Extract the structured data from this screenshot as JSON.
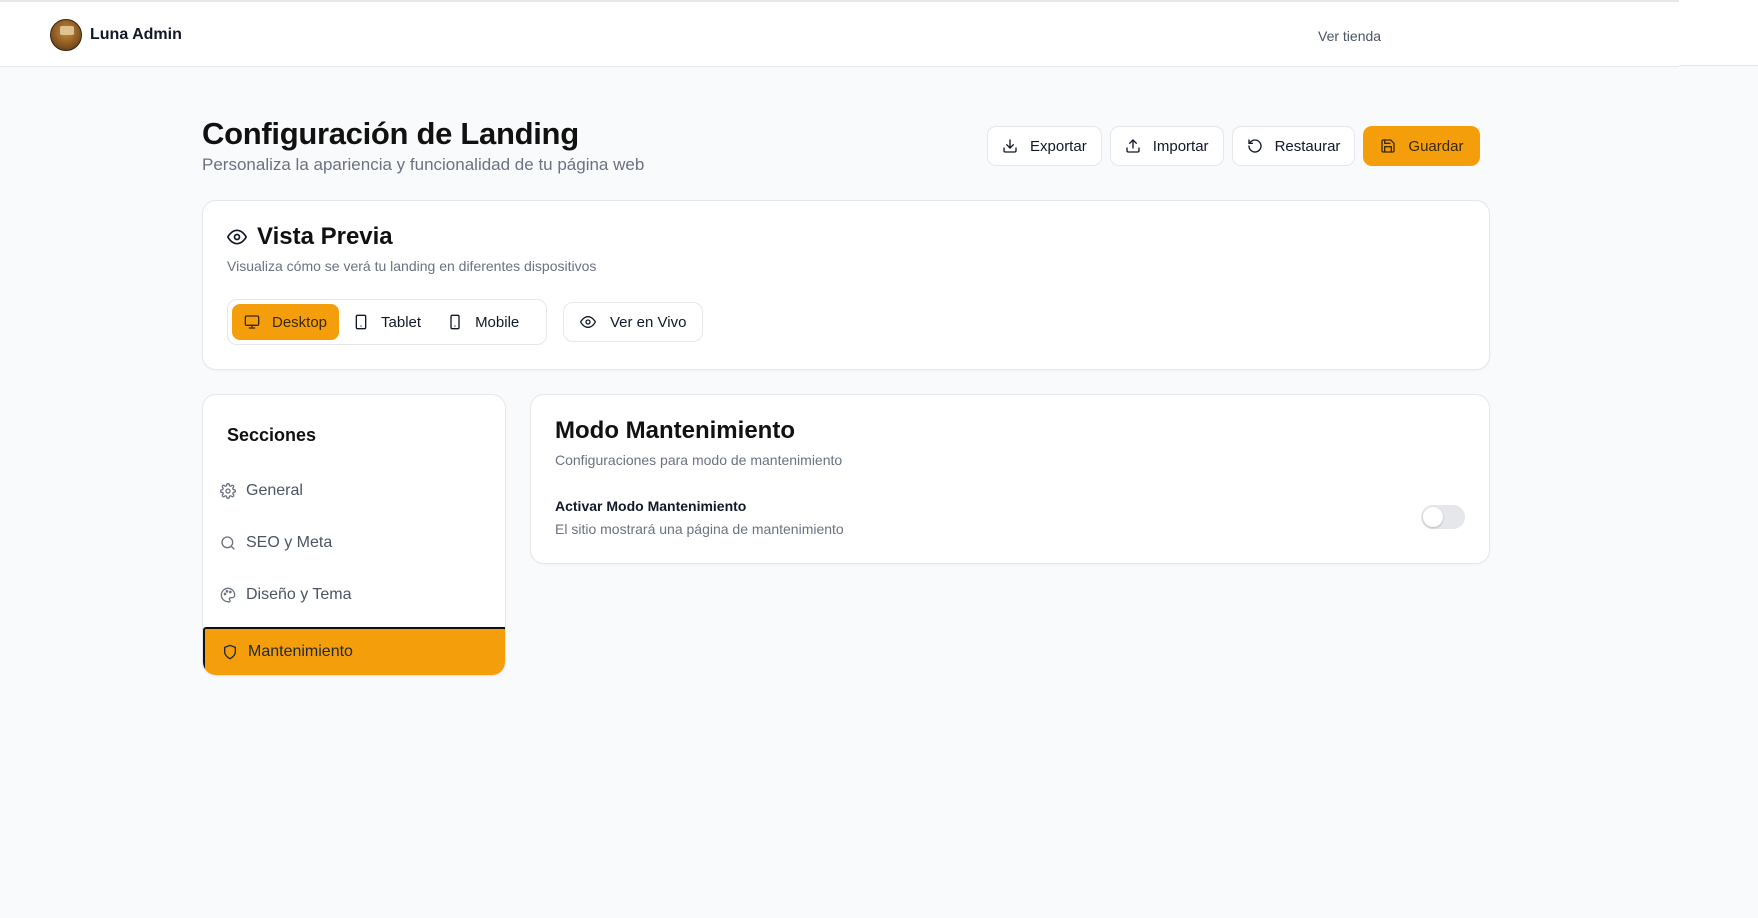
{
  "header": {
    "brand_name": "Luna Admin",
    "store_link": "Ver tienda"
  },
  "page": {
    "title": "Configuración de Landing",
    "subtitle": "Personaliza la apariencia y funcionalidad de tu página web"
  },
  "actions": {
    "export_label": "Exportar",
    "import_label": "Importar",
    "restore_label": "Restaurar",
    "save_label": "Guardar"
  },
  "preview": {
    "title": "Vista Previa",
    "description": "Visualiza cómo se verá tu landing en diferentes dispositivos",
    "devices": [
      {
        "label": "Desktop",
        "icon": "monitor-icon",
        "active": true
      },
      {
        "label": "Tablet",
        "icon": "tablet-icon",
        "active": false
      },
      {
        "label": "Mobile",
        "icon": "smartphone-icon",
        "active": false
      }
    ],
    "live_label": "Ver en Vivo"
  },
  "sections": {
    "title": "Secciones",
    "items": [
      {
        "label": "General",
        "icon": "gear-icon",
        "active": false
      },
      {
        "label": "SEO y Meta",
        "icon": "search-icon",
        "active": false
      },
      {
        "label": "Diseño y Tema",
        "icon": "palette-icon",
        "active": false
      },
      {
        "label": "Mantenimiento",
        "icon": "shield-icon",
        "active": true
      }
    ]
  },
  "maintenance": {
    "title": "Modo Mantenimiento",
    "description": "Configuraciones para modo de mantenimiento",
    "toggle_label": "Activar Modo Mantenimiento",
    "toggle_description": "El sitio mostrará una página de mantenimiento",
    "toggle_on": false
  },
  "colors": {
    "accent": "#f59e0b",
    "background": "#f9fafb",
    "border": "#e5e7eb",
    "text_muted": "#6b7280"
  }
}
